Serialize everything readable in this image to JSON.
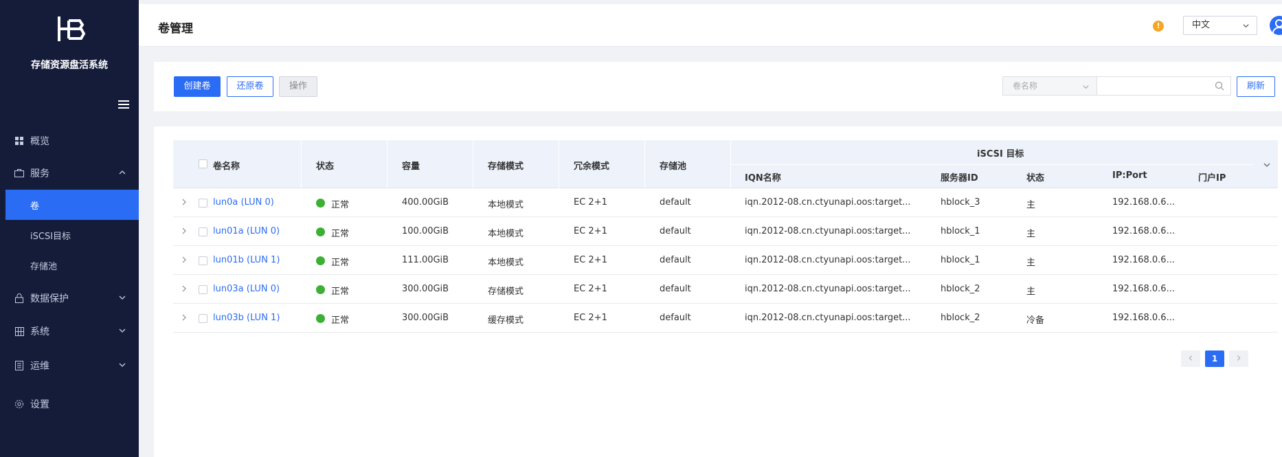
{
  "app": {
    "brand": "存储资源盘活系统"
  },
  "sidebar": {
    "items": [
      {
        "label": "概览",
        "icon": "dashboard-icon"
      },
      {
        "label": "服务",
        "icon": "briefcase-icon",
        "expanded": true,
        "children": [
          {
            "label": "卷",
            "active": true
          },
          {
            "label": "iSCSI目标"
          },
          {
            "label": "存储池"
          }
        ]
      },
      {
        "label": "数据保护",
        "icon": "lock-icon"
      },
      {
        "label": "系统",
        "icon": "system-icon"
      },
      {
        "label": "运维",
        "icon": "document-icon"
      },
      {
        "label": "设置",
        "icon": "gear-icon"
      }
    ]
  },
  "header": {
    "title": "卷管理",
    "alert": "!",
    "language": "中文"
  },
  "toolbar": {
    "create_label": "创建卷",
    "restore_label": "还原卷",
    "operate_label": "操作",
    "filter_field": "卷名称",
    "search_value": "",
    "refresh_label": "刷新"
  },
  "table": {
    "group_header": "iSCSI 目标",
    "columns": {
      "name": "卷名称",
      "status": "状态",
      "capacity": "容量",
      "storage_mode": "存储模式",
      "redundancy": "冗余模式",
      "pool": "存储池",
      "iqn": "IQN名称",
      "server_id": "服务器ID",
      "target_status": "状态",
      "ip_port": "IP:Port",
      "portal_ip": "门户IP"
    },
    "rows": [
      {
        "name": "lun0a (LUN 0)",
        "status": "正常",
        "capacity": "400.00GiB",
        "storage_mode": "本地模式",
        "redundancy": "EC 2+1",
        "pool": "default",
        "iqn": "iqn.2012-08.cn.ctyunapi.oos:target...",
        "server_id": "hblock_3",
        "target_status": "主",
        "ip_port": "192.168.0.6...",
        "portal_ip": ""
      },
      {
        "name": "lun01a (LUN 0)",
        "status": "正常",
        "capacity": "100.00GiB",
        "storage_mode": "本地模式",
        "redundancy": "EC 2+1",
        "pool": "default",
        "iqn": "iqn.2012-08.cn.ctyunapi.oos:target...",
        "server_id": "hblock_1",
        "target_status": "主",
        "ip_port": "192.168.0.6...",
        "portal_ip": ""
      },
      {
        "name": "lun01b (LUN 1)",
        "status": "正常",
        "capacity": "111.00GiB",
        "storage_mode": "本地模式",
        "redundancy": "EC 2+1",
        "pool": "default",
        "iqn": "iqn.2012-08.cn.ctyunapi.oos:target...",
        "server_id": "hblock_1",
        "target_status": "主",
        "ip_port": "192.168.0.6...",
        "portal_ip": ""
      },
      {
        "name": "lun03a (LUN 0)",
        "status": "正常",
        "capacity": "300.00GiB",
        "storage_mode": "存储模式",
        "redundancy": "EC 2+1",
        "pool": "default",
        "iqn": "iqn.2012-08.cn.ctyunapi.oos:target...",
        "server_id": "hblock_2",
        "target_status": "主",
        "ip_port": "192.168.0.6...",
        "portal_ip": ""
      },
      {
        "name": "lun03b (LUN 1)",
        "status": "正常",
        "capacity": "300.00GiB",
        "storage_mode": "缓存模式",
        "redundancy": "EC 2+1",
        "pool": "default",
        "iqn": "iqn.2012-08.cn.ctyunapi.oos:target...",
        "server_id": "hblock_2",
        "target_status": "冷备",
        "ip_port": "192.168.0.6...",
        "portal_ip": ""
      }
    ]
  },
  "pagination": {
    "current_page": "1"
  },
  "colors": {
    "sidebar_bg": "#141c3a",
    "accent": "#2b6cf5",
    "ok_status": "#3cb035",
    "alert": "#f5a623"
  }
}
